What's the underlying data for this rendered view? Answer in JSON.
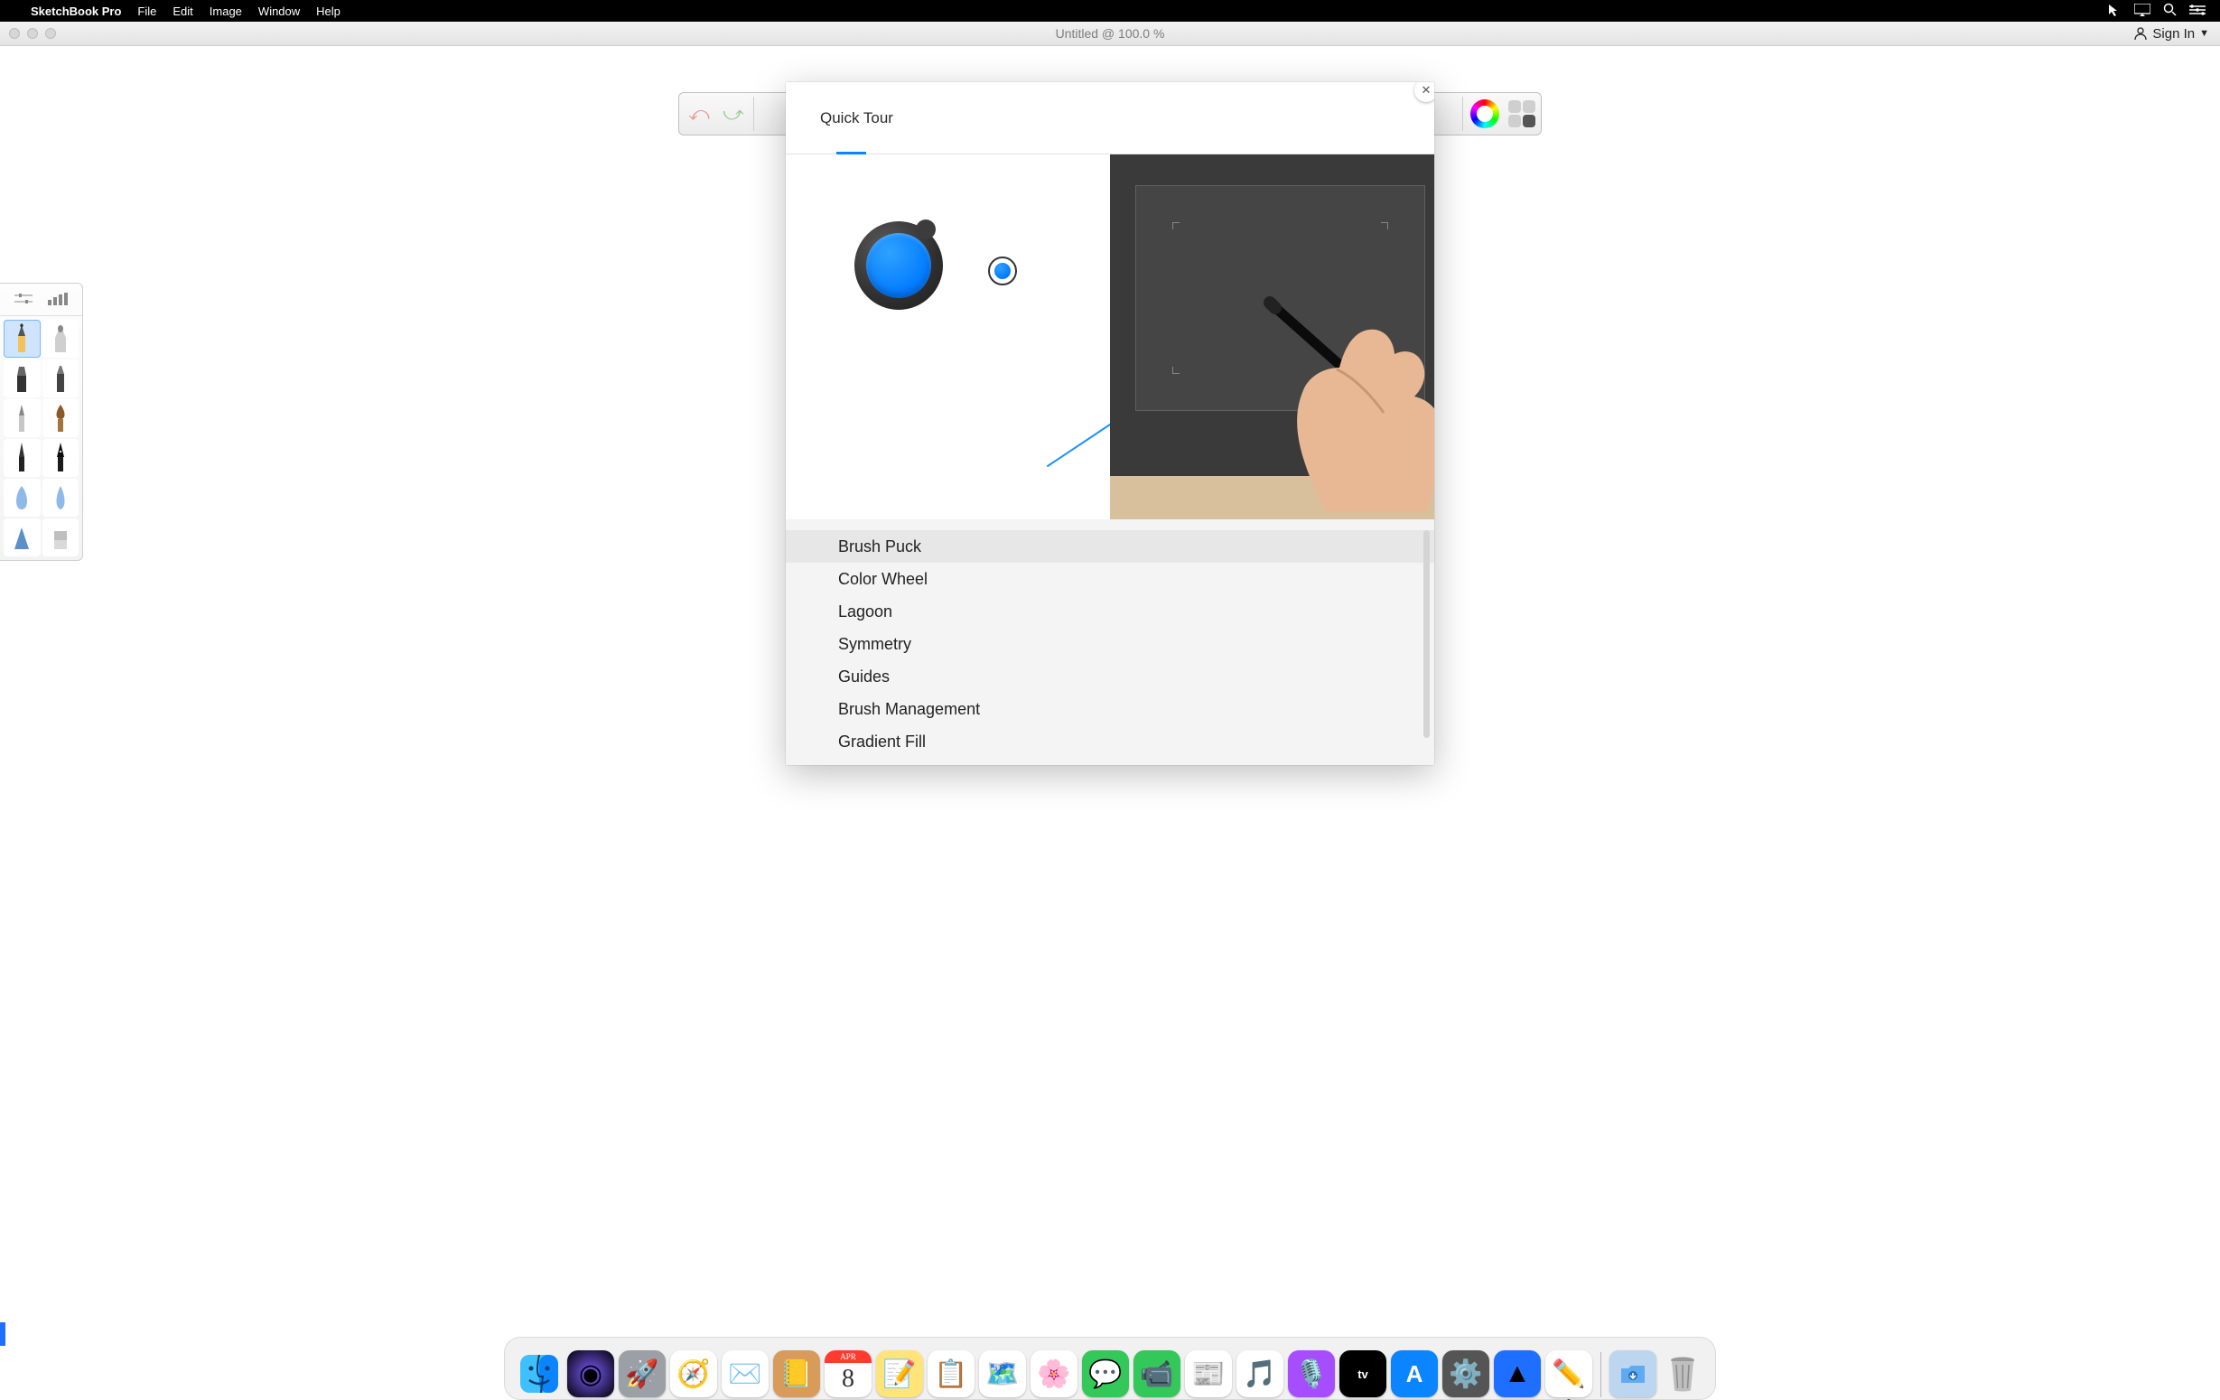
{
  "menubar": {
    "app_name": "SketchBook Pro",
    "items": [
      "File",
      "Edit",
      "Image",
      "Window",
      "Help"
    ]
  },
  "window": {
    "title": "Untitled @ 100.0 %",
    "signin_label": "Sign In"
  },
  "quick_tour": {
    "title": "Quick Tour",
    "items": [
      "Brush Puck",
      "Color Wheel",
      "Lagoon",
      "Symmetry",
      "Guides",
      "Brush Management",
      "Gradient Fill"
    ],
    "selected_index": 0
  },
  "brush_palette": {
    "brushes": [
      "pencil",
      "airbrush",
      "marker-chisel",
      "marker",
      "pen-fine",
      "brush-round",
      "ink-pen",
      "fountain-pen",
      "soft-round",
      "water-drop",
      "hard-triangle",
      "flat-brush"
    ],
    "selected_index": 0
  },
  "dock": {
    "items": [
      {
        "name": "finder",
        "bg": "linear-gradient(#3ec0ff,#0a84ff)",
        "glyph": "🙂"
      },
      {
        "name": "siri",
        "bg": "radial-gradient(circle at 50% 50%, #7b5cff, #000)",
        "glyph": "◉"
      },
      {
        "name": "launchpad",
        "bg": "#9aa0a6",
        "glyph": "🚀"
      },
      {
        "name": "safari",
        "bg": "#fff",
        "glyph": "🧭"
      },
      {
        "name": "mail",
        "bg": "#fff",
        "glyph": "✉️"
      },
      {
        "name": "contacts",
        "bg": "#d89b5b",
        "glyph": "📒"
      },
      {
        "name": "calendar",
        "bg": "#fff",
        "glyph": "📅"
      },
      {
        "name": "notes",
        "bg": "#ffe47a",
        "glyph": "📝"
      },
      {
        "name": "reminders",
        "bg": "#fff",
        "glyph": "📋"
      },
      {
        "name": "maps",
        "bg": "#fff",
        "glyph": "🗺️"
      },
      {
        "name": "photos",
        "bg": "#fff",
        "glyph": "🌸"
      },
      {
        "name": "messages",
        "bg": "#34c759",
        "glyph": "💬"
      },
      {
        "name": "facetime",
        "bg": "#34c759",
        "glyph": "📹"
      },
      {
        "name": "news",
        "bg": "#fff",
        "glyph": "📰"
      },
      {
        "name": "music",
        "bg": "#fff",
        "glyph": "🎵"
      },
      {
        "name": "podcasts",
        "bg": "#a64dff",
        "glyph": "🎙️"
      },
      {
        "name": "appletv",
        "bg": "#000",
        "glyph": "tv"
      },
      {
        "name": "appstore",
        "bg": "#0a84ff",
        "glyph": "A"
      },
      {
        "name": "preferences",
        "bg": "#555",
        "glyph": "⚙️"
      },
      {
        "name": "affinity",
        "bg": "#1e6fff",
        "glyph": "▲"
      },
      {
        "name": "sketchbook",
        "bg": "#fff",
        "glyph": "✏️",
        "running": true
      }
    ]
  },
  "calendar_tile": {
    "month": "APR",
    "day": "8"
  }
}
